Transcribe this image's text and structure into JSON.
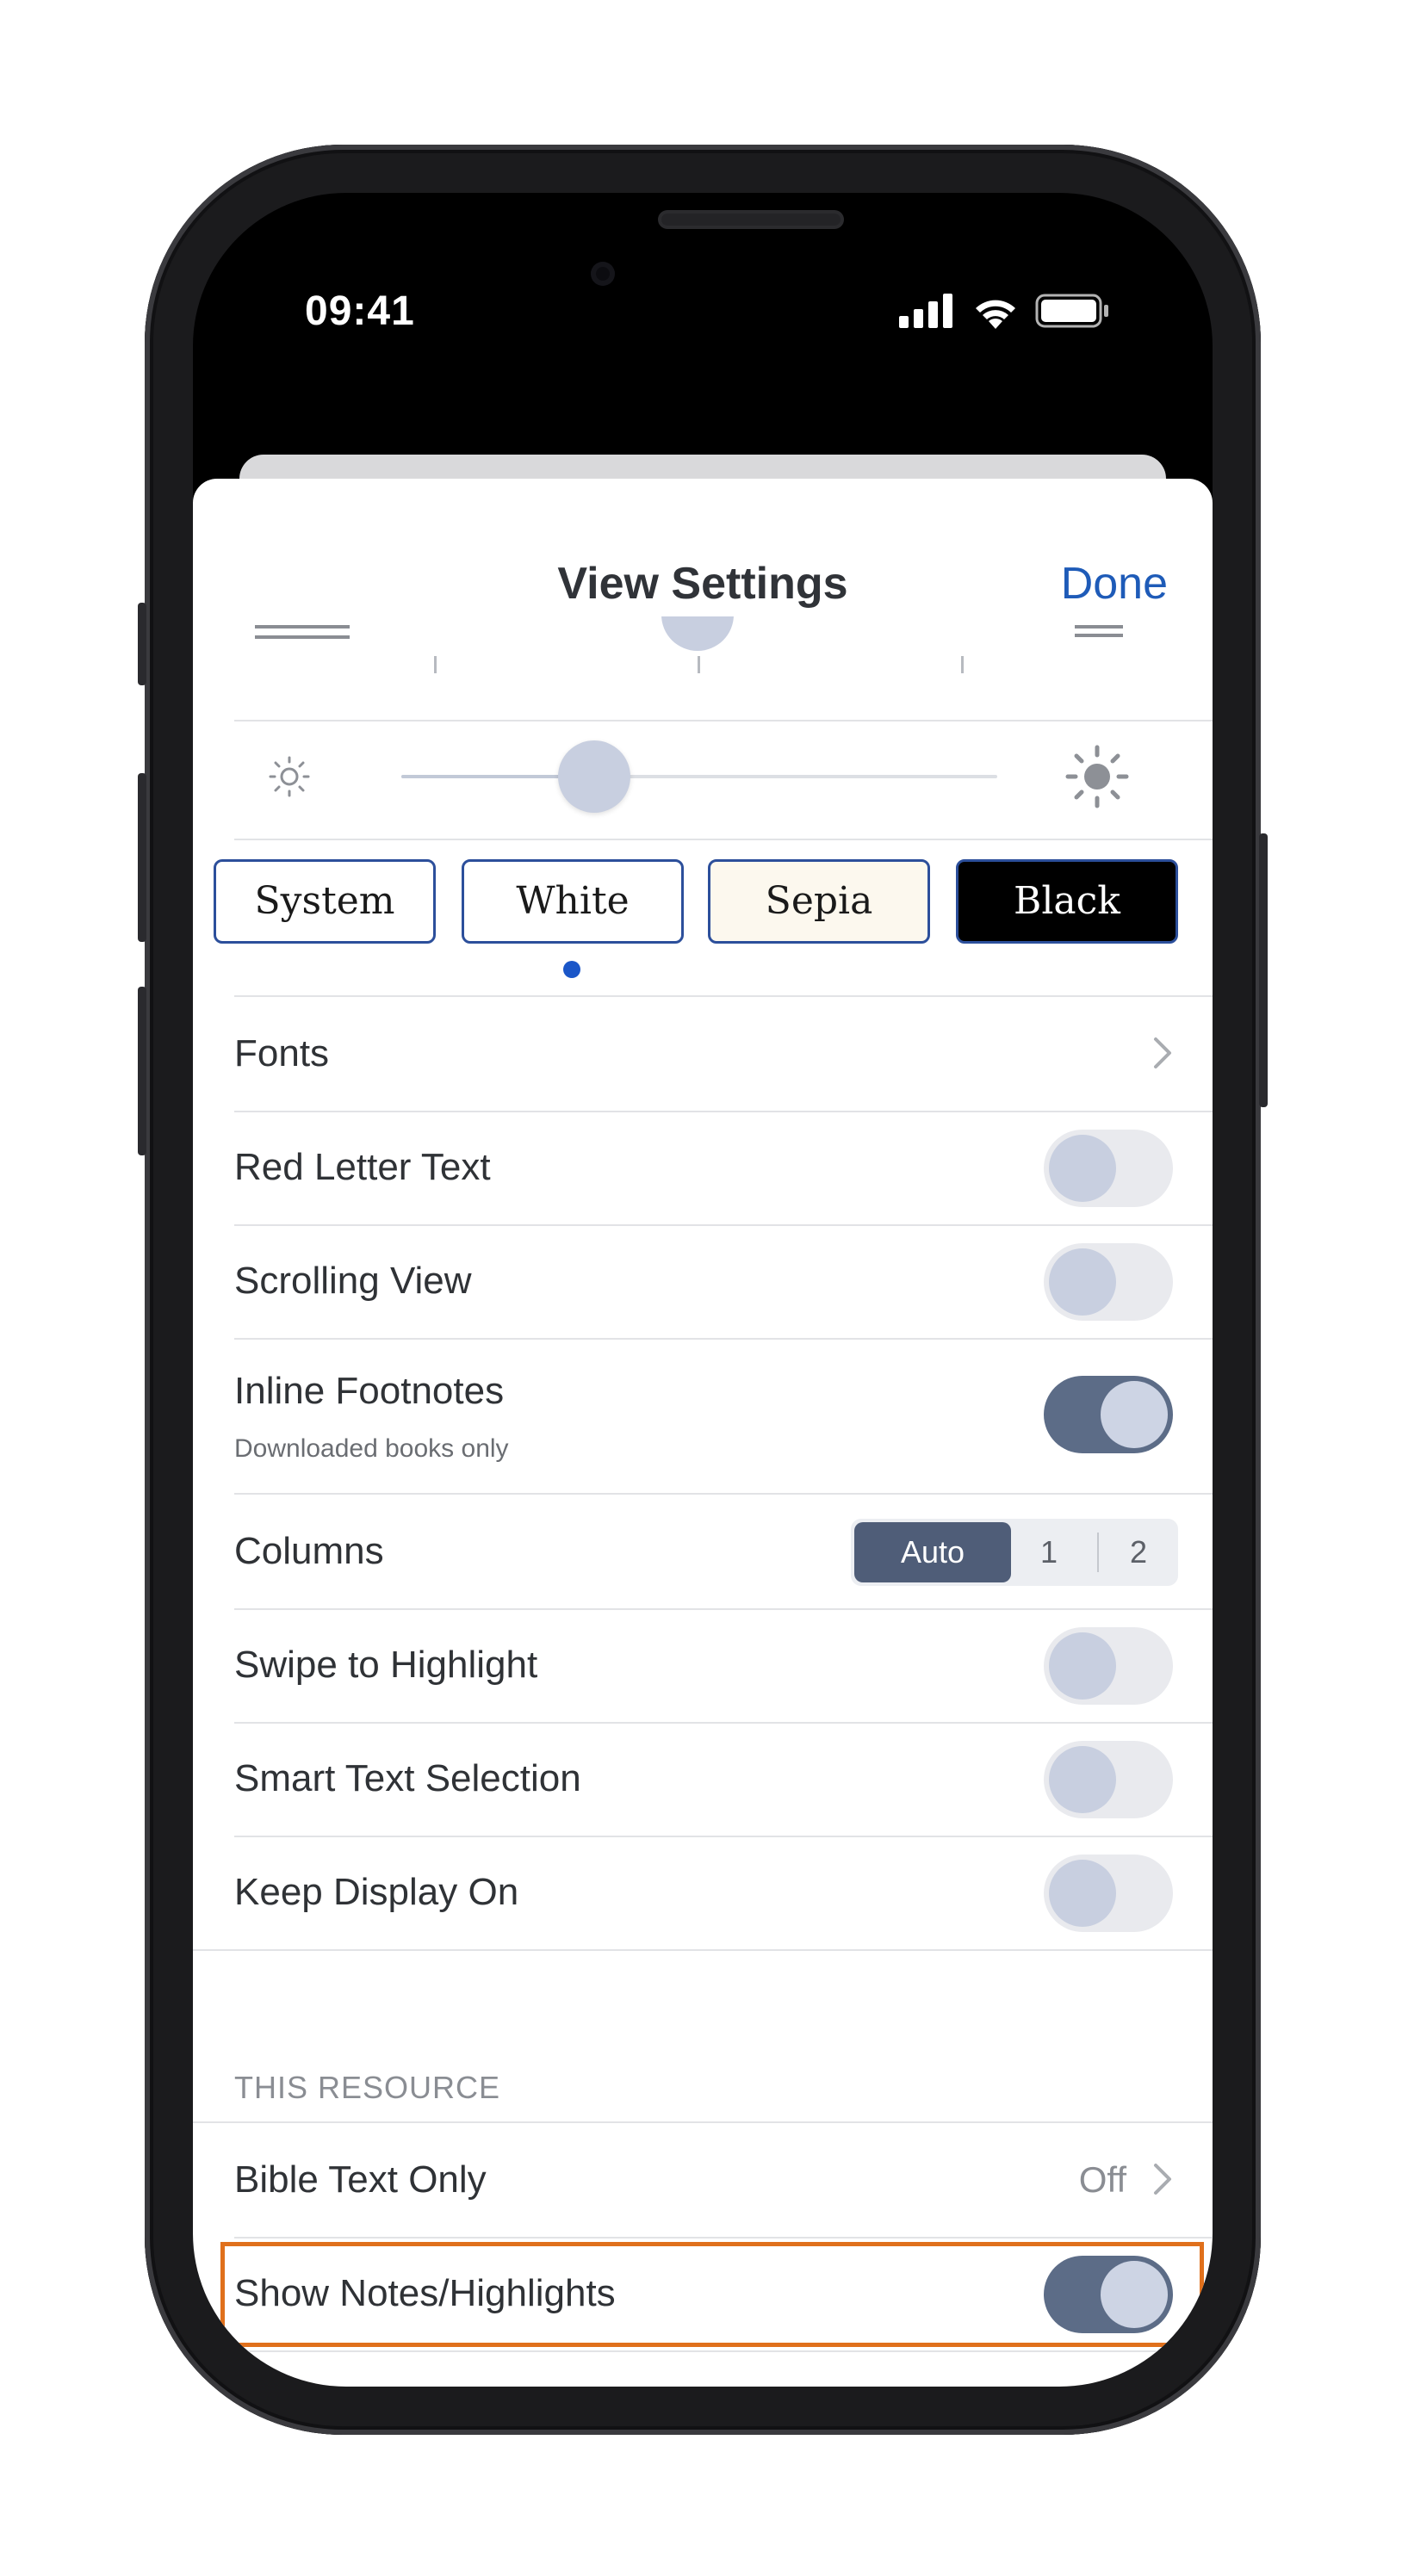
{
  "status_bar": {
    "time": "09:41"
  },
  "header": {
    "title": "View Settings",
    "done_label": "Done"
  },
  "brightness": {
    "level_percent": 32
  },
  "themes": {
    "items": [
      "System",
      "White",
      "Sepia",
      "Black"
    ],
    "selected": "White",
    "colors": {
      "system": "#ffffff",
      "white": "#ffffff",
      "sepia": "#fcf8ee",
      "black": "#000000"
    }
  },
  "settings": {
    "fonts": {
      "label": "Fonts"
    },
    "red_letter": {
      "label": "Red Letter Text",
      "on": false
    },
    "scrolling": {
      "label": "Scrolling View",
      "on": false
    },
    "inline_footnotes": {
      "label": "Inline Footnotes",
      "sub": "Downloaded books only",
      "on": true
    },
    "columns": {
      "label": "Columns",
      "options": [
        "Auto",
        "1",
        "2"
      ],
      "selected": "Auto"
    },
    "swipe_highlight": {
      "label": "Swipe to Highlight",
      "on": false
    },
    "smart_selection": {
      "label": "Smart Text Selection",
      "on": false
    },
    "keep_display": {
      "label": "Keep Display On",
      "on": false
    }
  },
  "resource": {
    "header": "THIS RESOURCE",
    "bible_text_only": {
      "label": "Bible Text Only",
      "value": "Off"
    },
    "show_notes": {
      "label": "Show Notes/Highlights",
      "on": true
    }
  },
  "accent_colors": {
    "link": "#1e5bb8",
    "highlight_box": "#e0701c",
    "toggle_on": "#5c6c87"
  }
}
